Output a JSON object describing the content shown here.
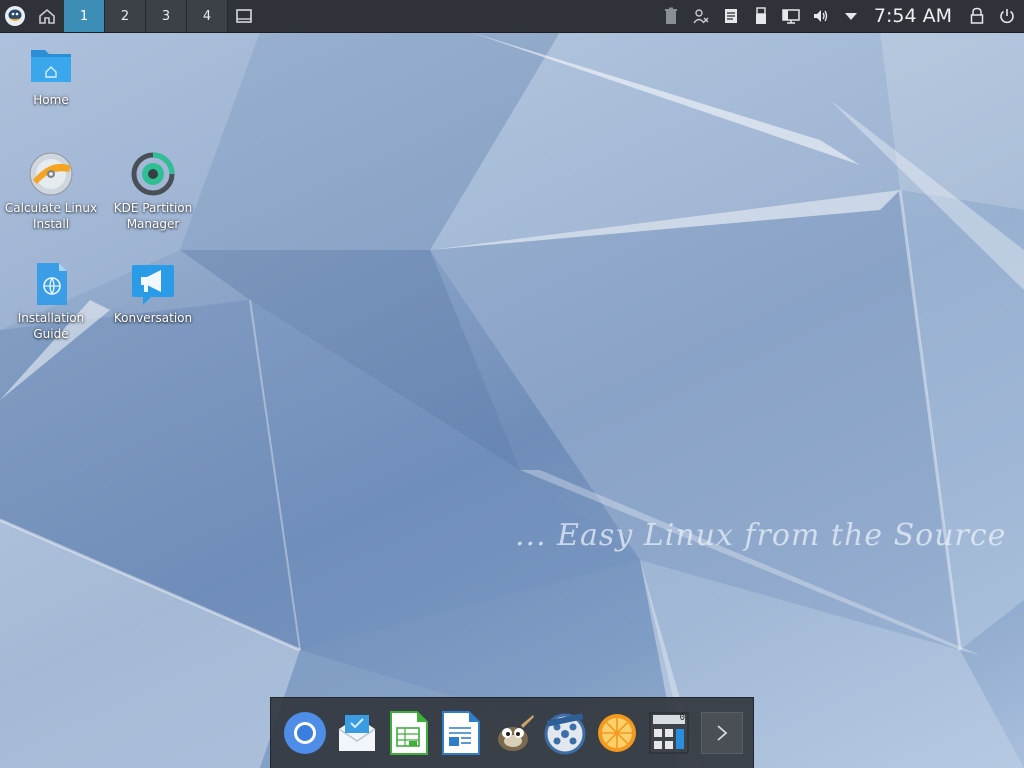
{
  "top_panel": {
    "pager": {
      "desktops": [
        "1",
        "2",
        "3",
        "4"
      ],
      "active": "1"
    },
    "tray_icons": [
      "clipboard-trash-icon",
      "network-person-icon",
      "notes-icon",
      "usb-device-icon",
      "display-network-icon",
      "volume-icon",
      "tray-expand-icon"
    ],
    "clock": "7:54 AM"
  },
  "desktop_icons": {
    "home": "Home",
    "calculate_install": "Calculate Linux Install",
    "kde_partition": "KDE Partition Manager",
    "installation_guide": "Installation Guide",
    "konversation": "Konversation"
  },
  "wallpaper": {
    "tagline": "... Easy Linux from the Source"
  },
  "dock": {
    "apps": [
      "chromium-icon",
      "mail-client-icon",
      "spreadsheet-icon",
      "writer-icon",
      "gimp-icon",
      "video-editor-icon",
      "orange-player-icon",
      "calculator-icon"
    ],
    "calculator_display": "0"
  },
  "colors": {
    "panel": "#2f3339",
    "active_desktop": "#3d8eb6",
    "accent": "#3da0e0"
  }
}
